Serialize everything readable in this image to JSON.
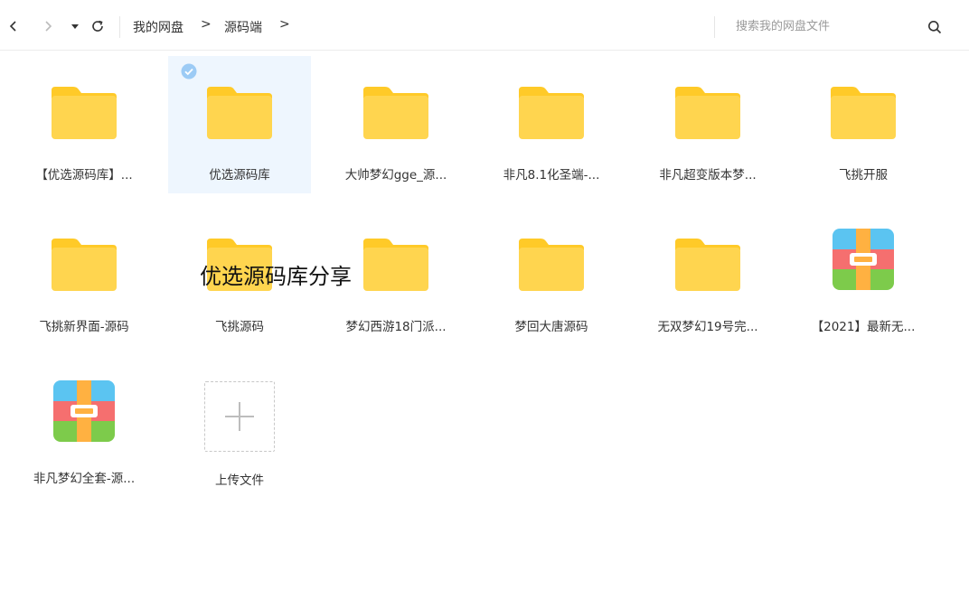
{
  "toolbar": {
    "breadcrumb": [
      "我的网盘",
      "源码端"
    ],
    "breadcrumb_separator": ">",
    "search_placeholder": "搜索我的网盘文件"
  },
  "overlay_text": "优选源码库分享",
  "items": [
    {
      "name": "【优选源码库】...",
      "type": "folder"
    },
    {
      "name": "优选源码库",
      "type": "folder",
      "selected": true
    },
    {
      "name": "大帅梦幻gge_源...",
      "type": "folder"
    },
    {
      "name": "非凡8.1化圣端-...",
      "type": "folder"
    },
    {
      "name": "非凡超变版本梦...",
      "type": "folder"
    },
    {
      "name": "飞挑开服",
      "type": "folder"
    },
    {
      "name": "飞挑新界面-源码",
      "type": "folder"
    },
    {
      "name": "飞挑源码",
      "type": "folder"
    },
    {
      "name": "梦幻西游18门派...",
      "type": "folder"
    },
    {
      "name": "梦回大唐源码",
      "type": "folder"
    },
    {
      "name": "无双梦幻19号完...",
      "type": "folder"
    },
    {
      "name": "【2021】最新无...",
      "type": "archive"
    },
    {
      "name": "非凡梦幻全套-源...",
      "type": "archive"
    }
  ],
  "upload": {
    "label": "上传文件"
  },
  "colors": {
    "folder_body": "#FFD54F",
    "folder_tab": "#FFCA28",
    "selected_bg": "#EEF6FE",
    "check": "#9CCBF5"
  }
}
